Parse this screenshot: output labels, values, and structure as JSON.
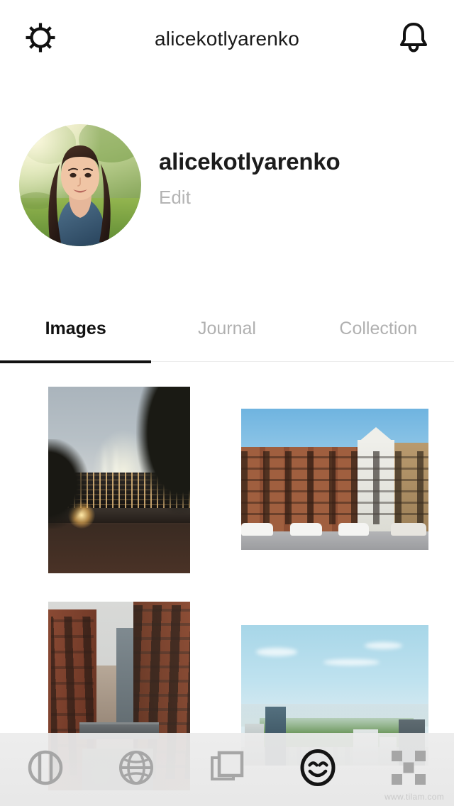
{
  "header": {
    "title": "alicekotlyarenko",
    "settings_icon": "gear-icon",
    "notifications_icon": "bell-icon"
  },
  "profile": {
    "avatar_alt": "profile-photo",
    "username": "alicekotlyarenko",
    "edit_label": "Edit"
  },
  "tabs": [
    {
      "label": "Images",
      "active": true
    },
    {
      "label": "Journal",
      "active": false
    },
    {
      "label": "Collection",
      "active": false
    }
  ],
  "grid": {
    "photos": [
      {
        "name": "nyc-skyline-tribute-lights-at-dusk"
      },
      {
        "name": "brooklyn-brownstone-row-houses"
      },
      {
        "name": "brick-warehouses-with-skybridge"
      },
      {
        "name": "central-park-aerial-view"
      }
    ]
  },
  "bottom_nav": [
    {
      "icon": "aperture-icon",
      "active": false
    },
    {
      "icon": "globe-icon",
      "active": false
    },
    {
      "icon": "layers-icon",
      "active": false
    },
    {
      "icon": "smiley-face-icon",
      "active": true
    },
    {
      "icon": "grid-checker-icon",
      "active": false
    }
  ],
  "watermark": "www.tilam.com",
  "colors": {
    "active": "#111111",
    "inactive": "#b0b0b0",
    "nav_icon": "#a6a6a6",
    "nav_icon_active": "#141414",
    "background": "#ffffff",
    "nav_background": "#ececec"
  }
}
